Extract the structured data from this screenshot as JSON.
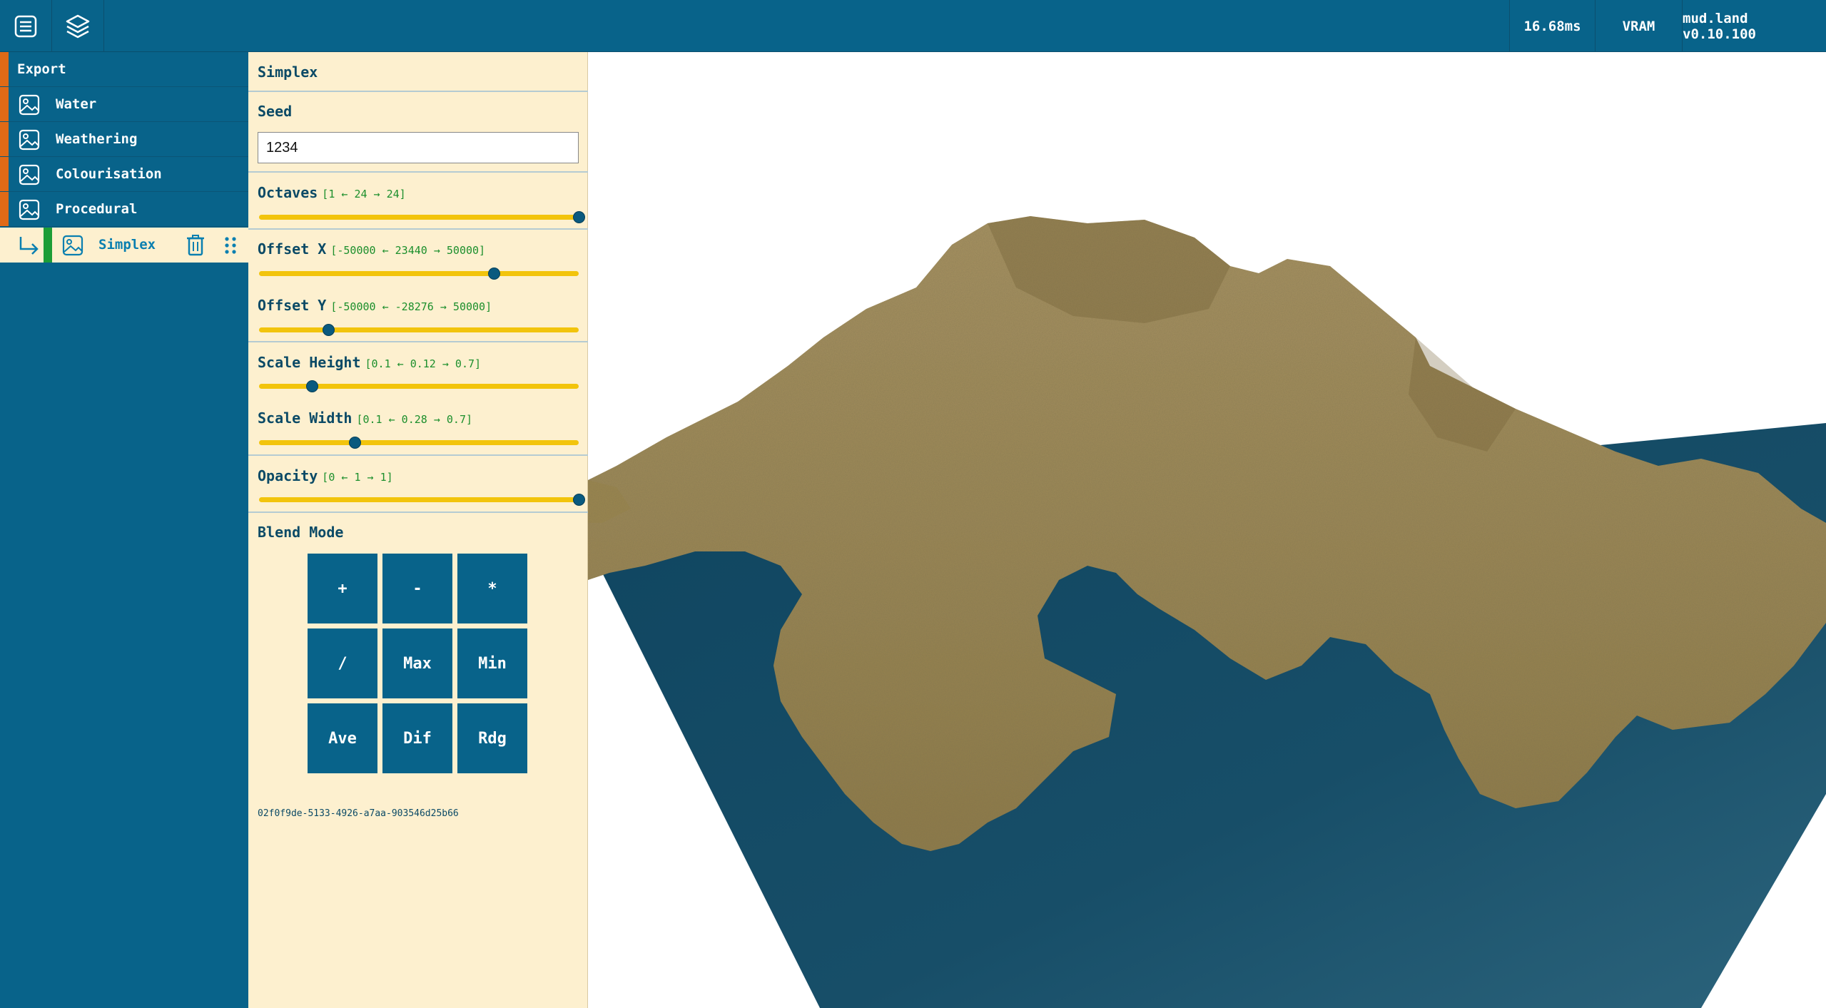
{
  "topbar": {
    "menu_icon": "menu-list-icon",
    "layers_icon": "layers-icon",
    "frame_time": "16.68ms",
    "vram_label": "VRAM",
    "version": "mud.land v0.10.100"
  },
  "sidebar": {
    "items": [
      {
        "label": "Export"
      },
      {
        "label": "Water",
        "icon": "image-icon"
      },
      {
        "label": "Weathering",
        "icon": "image-icon"
      },
      {
        "label": "Colourisation",
        "icon": "image-icon"
      },
      {
        "label": "Procedural",
        "icon": "image-icon"
      }
    ],
    "child": {
      "label": "Simplex",
      "icon": "image-icon",
      "arrow_icon": "return-arrow-icon",
      "delete_icon": "trash-icon",
      "drag_icon": "drag-handle-icon"
    }
  },
  "panel": {
    "title": "Simplex",
    "seed": {
      "label": "Seed",
      "value": "1234"
    },
    "octaves": {
      "label": "Octaves",
      "range": "[1 ← 24 → 24]",
      "fraction": 1.0
    },
    "offset_x": {
      "label": "Offset X",
      "range": "[-50000 ← 23440 → 50000]",
      "fraction": 0.7344
    },
    "offset_y": {
      "label": "Offset Y",
      "range": "[-50000 ← -28276 → 50000]",
      "fraction": 0.2172
    },
    "scale_height": {
      "label": "Scale Height",
      "range": "[0.1 ← 0.12 → 0.7]",
      "fraction": 0.1667
    },
    "scale_width": {
      "label": "Scale Width",
      "range": "[0.1 ← 0.28 → 0.7]",
      "fraction": 0.3
    },
    "opacity": {
      "label": "Opacity",
      "range": "[0 ← 1 → 1]",
      "fraction": 1.0
    },
    "blend_mode": {
      "label": "Blend Mode",
      "buttons": [
        "+",
        "-",
        "*",
        "/",
        "Max",
        "Min",
        "Ave",
        "Dif",
        "Rdg"
      ]
    },
    "uuid": "02f0f9de-5133-4926-a7aa-903546d25b66"
  },
  "colors": {
    "topbar": "#08638a",
    "panel_bg": "#fdf0cf",
    "accent_orange": "#e06a16",
    "accent_green": "#1d9d37",
    "slider_track": "#f2c40c",
    "terrain": "#a58f5a",
    "water": "#174e68"
  }
}
